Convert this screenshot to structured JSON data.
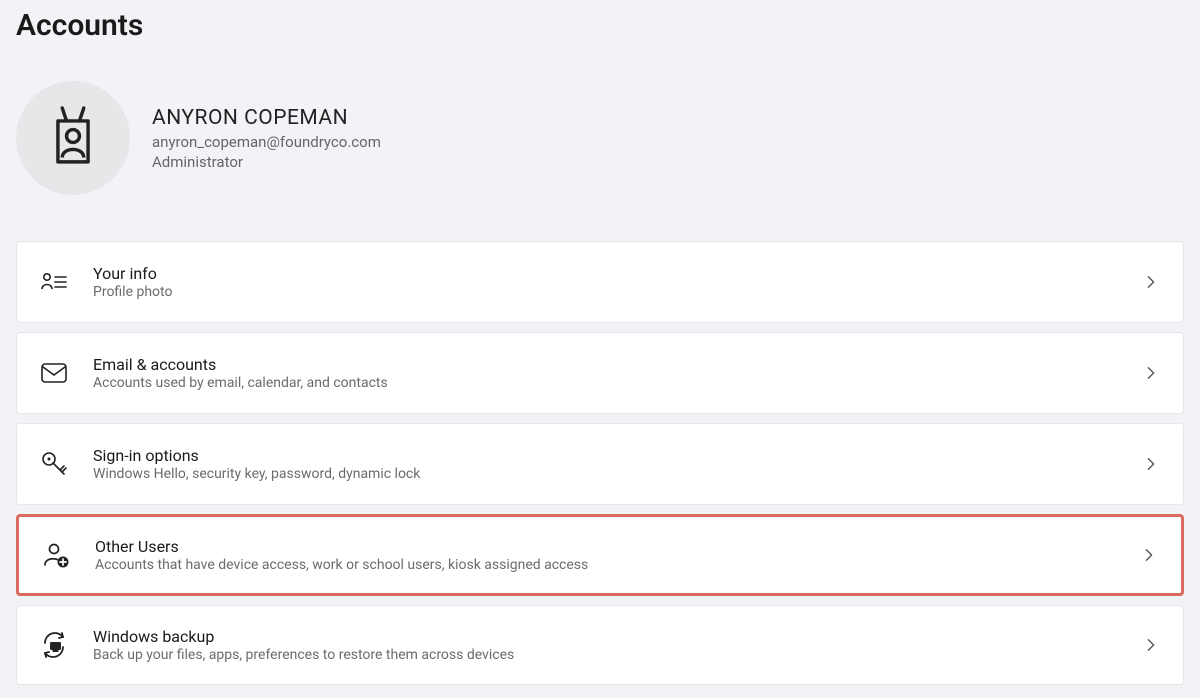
{
  "page": {
    "title": "Accounts"
  },
  "profile": {
    "name": "ANYRON COPEMAN",
    "email": "anyron_copeman@foundryco.com",
    "role": "Administrator"
  },
  "items": [
    {
      "icon": "person-list",
      "title": "Your info",
      "subtitle": "Profile photo",
      "highlighted": false
    },
    {
      "icon": "mail",
      "title": "Email & accounts",
      "subtitle": "Accounts used by email, calendar, and contacts",
      "highlighted": false
    },
    {
      "icon": "key",
      "title": "Sign-in options",
      "subtitle": "Windows Hello, security key, password, dynamic lock",
      "highlighted": false
    },
    {
      "icon": "other-users",
      "title": "Other Users",
      "subtitle": "Accounts that have device access, work or school users, kiosk assigned access",
      "highlighted": true
    },
    {
      "icon": "backup",
      "title": "Windows backup",
      "subtitle": "Back up your files, apps, preferences to restore them across devices",
      "highlighted": false
    }
  ]
}
